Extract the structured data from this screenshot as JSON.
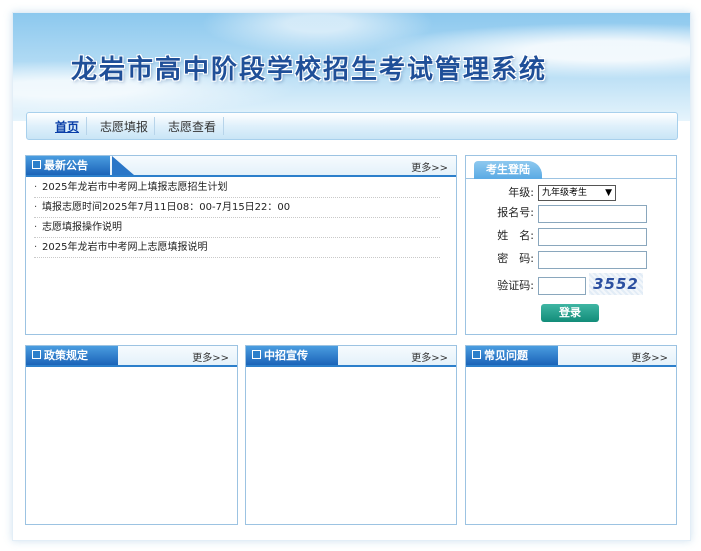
{
  "banner": {
    "title": "龙岩市高中阶段学校招生考试管理系统"
  },
  "nav": {
    "items": [
      {
        "label": "首页",
        "active": true
      },
      {
        "label": "志愿填报",
        "active": false
      },
      {
        "label": "志愿查看",
        "active": false
      }
    ]
  },
  "announcements": {
    "title": "最新公告",
    "more": "更多>>",
    "items": [
      {
        "text": "2025年龙岩市中考网上填报志愿招生计划"
      },
      {
        "text": "填报志愿时间2025年7月11日08：00-7月15日22：00"
      },
      {
        "text": "志愿填报操作说明"
      },
      {
        "text": "2025年龙岩市中考网上志愿填报说明"
      }
    ]
  },
  "login": {
    "title": "考生登陆",
    "grade_label": "年级:",
    "grade_value": "九年级考生",
    "regno_label": "报名号:",
    "name_label": "姓　名:",
    "password_label": "密　码:",
    "captcha_label": "验证码:",
    "captcha_text": "3552",
    "submit_label": "登录"
  },
  "policy": {
    "title": "政策规定",
    "more": "更多>>"
  },
  "promo": {
    "title": "中招宣传",
    "more": "更多>>"
  },
  "faq": {
    "title": "常见问题",
    "more": "更多>>"
  },
  "bullet": "·"
}
